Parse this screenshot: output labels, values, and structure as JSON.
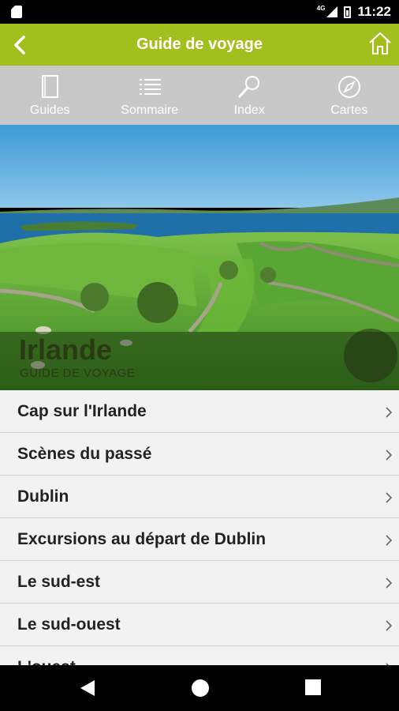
{
  "status": {
    "time": "11:22",
    "network": "4G"
  },
  "appbar": {
    "title": "Guide de voyage"
  },
  "toolbar": {
    "items": [
      {
        "label": "Guides",
        "icon": "book-icon"
      },
      {
        "label": "Sommaire",
        "icon": "list-icon"
      },
      {
        "label": "Index",
        "icon": "magnifier-icon"
      },
      {
        "label": "Cartes",
        "icon": "compass-icon"
      }
    ]
  },
  "hero": {
    "title": "Irlande",
    "subtitle": "GUIDE DE VOYAGE"
  },
  "chapters": [
    "Cap sur l'Irlande",
    "Scènes du passé",
    "Dublin",
    "Excursions au départ de Dublin",
    "Le sud-est",
    "Le sud-ouest",
    "L'ouest"
  ],
  "colors": {
    "accent": "#a3bf1e",
    "toolbar": "#c8c8c8"
  }
}
